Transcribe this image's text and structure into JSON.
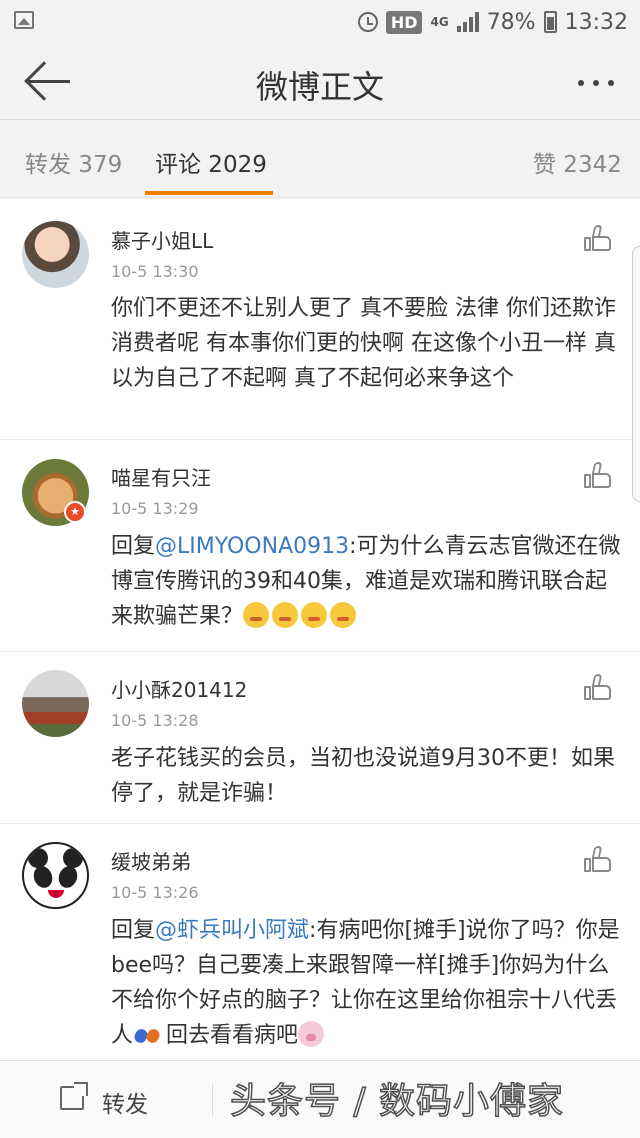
{
  "status_bar": {
    "network": "4G",
    "hd": "HD",
    "battery": "78%",
    "time": "13:32"
  },
  "header": {
    "title": "微博正文"
  },
  "tabs": [
    {
      "label": "转发 379"
    },
    {
      "label": "评论 2029",
      "active": true
    },
    {
      "label": "赞 2342"
    }
  ],
  "comments": [
    {
      "name": "慕子小姐LL",
      "time": "10-5 13:30",
      "text": "你们不更还不让别人更了 真不要脸 法律 你们还欺诈消费者呢 有本事你们更的快啊 在这像个小丑一样 真以为自己了不起啊 真了不起何必来争这个"
    },
    {
      "name": "喵星有只汪",
      "time": "10-5 13:29",
      "reply_prefix": "回复",
      "mention": "@LIMYOONA0913",
      "text": ":可为什么青云志官微还在微博宣传腾讯的39和40集，难道是欢瑞和腾讯联合起来欺骗芒果？"
    },
    {
      "name": "小小酥201412",
      "time": "10-5 13:28",
      "text": "老子花钱买的会员，当初也没说道9月30不更！如果停了，就是诈骗！"
    },
    {
      "name": "缓坡弟弟",
      "time": "10-5 13:26",
      "reply_prefix": "回复",
      "mention": "@虾兵叫小阿斌",
      "text": ":有病吧你[摊手]说你了吗？你是bee吗？自己要凑上来跟智障一样[摊手]你妈为什么不给你个好点的脑子？让你在这里给你祖宗十八代丢人",
      "text_tail": "回去看看病吧"
    }
  ],
  "bottom_bar": {
    "share_label": "转发"
  },
  "watermark": "头条号 / 数码小傅家",
  "icons": {
    "back": "back-arrow-icon",
    "more": "more-dots-icon",
    "like": "thumbs-up-icon",
    "share": "share-icon"
  },
  "colors": {
    "accent": "#f08200",
    "mention": "#3a7abf"
  }
}
